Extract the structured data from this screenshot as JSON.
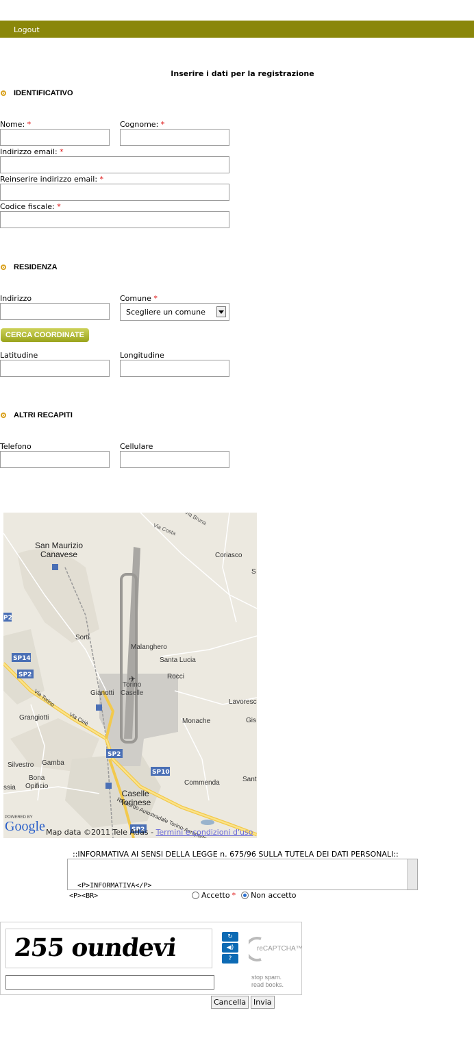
{
  "header": {
    "logout": "Logout",
    "bar_color": "#8a870a"
  },
  "page_title": "Inserire i dati per la registrazione",
  "required_mark": "*",
  "sections": {
    "identificativo": {
      "title": "IDENTIFICATIVO",
      "nome_label": "Nome:",
      "cognome_label": "Cognome:",
      "email_label": "Indirizzo email:",
      "email2_label": "Reinserire indirizzo email:",
      "cf_label": "Codice fiscale:"
    },
    "residenza": {
      "title": "RESIDENZA",
      "indirizzo_label": "Indirizzo",
      "comune_label": "Comune",
      "comune_value": "Scegliere un comune",
      "cerca_button": "CERCA COORDINATE",
      "lat_label": "Latitudine",
      "lon_label": "Longitudine"
    },
    "recapiti": {
      "title": "ALTRI RECAPITI",
      "telefono_label": "Telefono",
      "cellulare_label": "Cellulare"
    }
  },
  "map": {
    "places": [
      "San Maurizio",
      "Canavese",
      "Coriasco",
      "S",
      "Sorti",
      "Malanghero",
      "Santa Lucia",
      "Rocci",
      "Torino",
      "Caselle",
      "Gianotti",
      "Lavoresc",
      "Grangiotti",
      "Monache",
      "Gis",
      "Silvestro",
      "Gamba",
      "Bona",
      "Opificio",
      "ssia",
      "Commenda",
      "Sant",
      "Caselle",
      "Torinese",
      "Via Costa",
      "Via Bruna",
      "Via Torino",
      "Via Ciriè",
      "Raccordo Autostradale Torino-Aeroporto di Caselle"
    ],
    "shields": [
      "P2",
      "SP14",
      "SP2",
      "SP2",
      "SP10",
      "SP2"
    ],
    "powered_by": "POWERED BY",
    "google": "Google",
    "data_text": "Map data ©2011 Tele Atlas -",
    "terms_link": "Termini e condizioni d'uso"
  },
  "informativa": {
    "title": "::INFORMATIVA AI SENSI DELLA LEGGE n. 675/96 SULLA TUTELA DEI DATI PERSONALI::",
    "text": "<P>INFORMATIVA</P>\n<P><BR>",
    "accetto": "Accetto",
    "non_accetto": "Non accetto",
    "selected": "non_accetto"
  },
  "captcha": {
    "challenge": "255 oundevi",
    "recaptcha_logo": "reCAPTCHA™",
    "stop_spam": "stop spam.",
    "read_books": "read books.",
    "refresh_icon": "refresh-icon",
    "audio_icon": "audio-icon",
    "help_icon": "help-icon"
  },
  "buttons": {
    "cancel": "Cancella",
    "submit": "Invia"
  }
}
